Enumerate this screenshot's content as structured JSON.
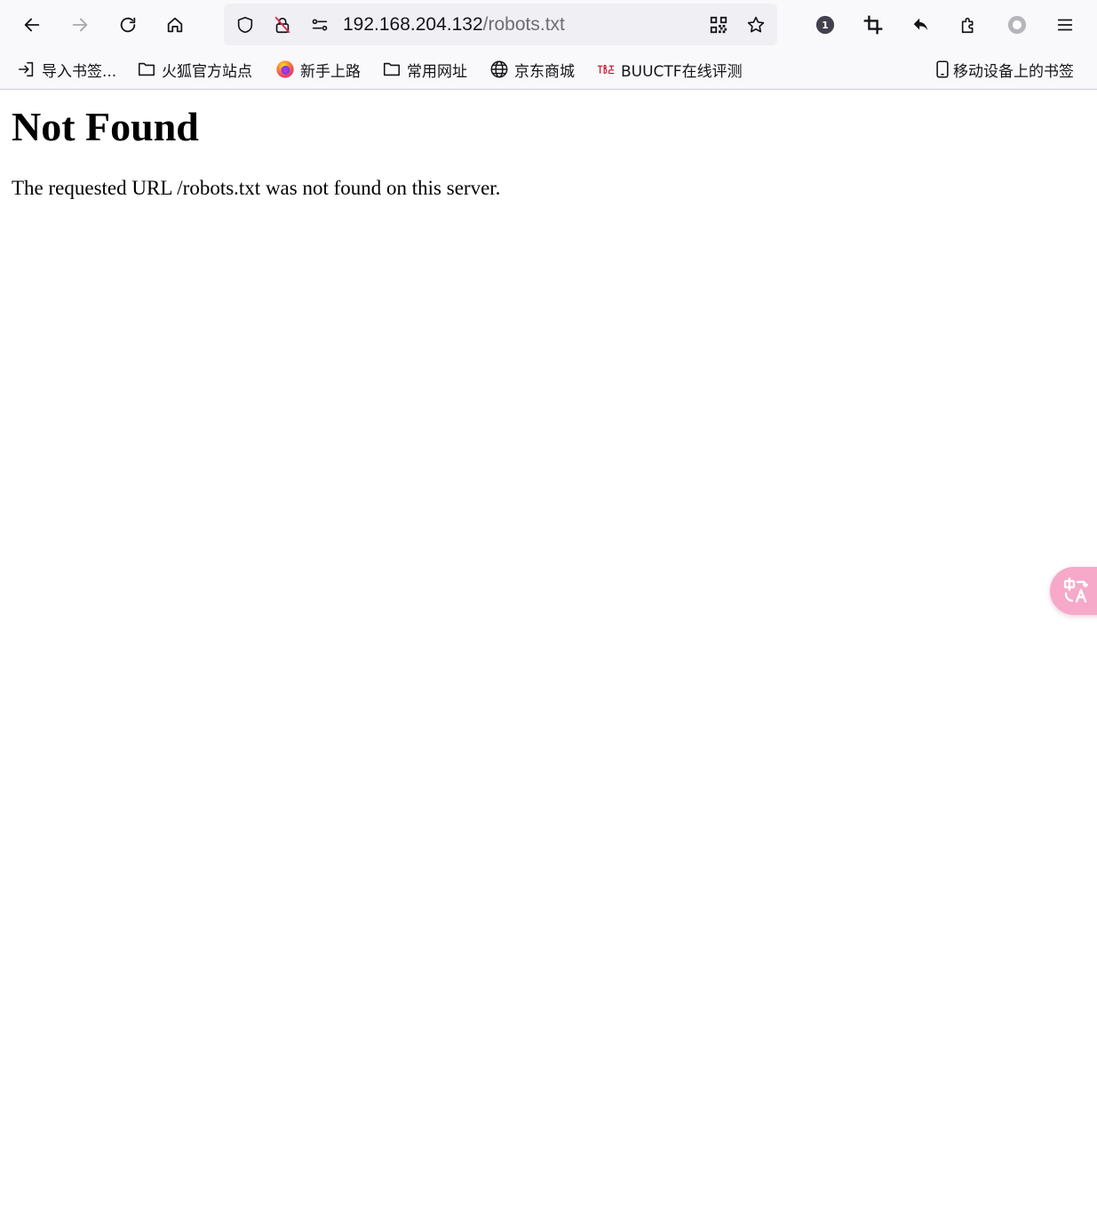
{
  "browser": {
    "url": {
      "host": "192.168.204.132",
      "path": "/robots.txt"
    },
    "extension_badge": "1",
    "bookmarks": [
      {
        "label": "导入书签...",
        "icon": "import-icon"
      },
      {
        "label": "火狐官方站点",
        "icon": "folder-icon"
      },
      {
        "label": "新手上路",
        "icon": "firefox-icon"
      },
      {
        "label": "常用网址",
        "icon": "folder-icon"
      },
      {
        "label": "京东商城",
        "icon": "globe-icon"
      },
      {
        "label": "BUUCTF在线评测",
        "icon": "buuctf-icon"
      }
    ],
    "mobile_bookmarks": {
      "label": "移动设备上的书签",
      "icon": "mobile-icon"
    },
    "colors": {
      "toolbar_bg": "#f9f9fb",
      "urlbar_bg": "#f0f0f4",
      "translate_button": "#f6a9c9"
    }
  },
  "page": {
    "heading": "Not Found",
    "message": "The requested URL /robots.txt was not found on this server."
  }
}
